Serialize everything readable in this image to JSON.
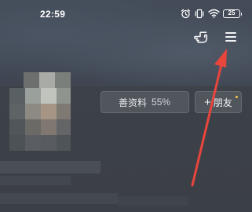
{
  "status_bar": {
    "time": "22:59",
    "battery": "25",
    "icons": [
      "alarm-icon",
      "vibrate-icon",
      "wifi-icon",
      "battery-icon"
    ]
  },
  "header": {
    "icons": [
      "hand-pointer-icon",
      "menu-icon"
    ]
  },
  "profile": {
    "complete_label": "善资料",
    "complete_pct": "55%",
    "add_friend_plus": "+",
    "add_friend_label": "朋友"
  },
  "annotation": {
    "arrow_color": "#e8453c"
  },
  "colors": {
    "badge_dot": "#f3c64a"
  }
}
